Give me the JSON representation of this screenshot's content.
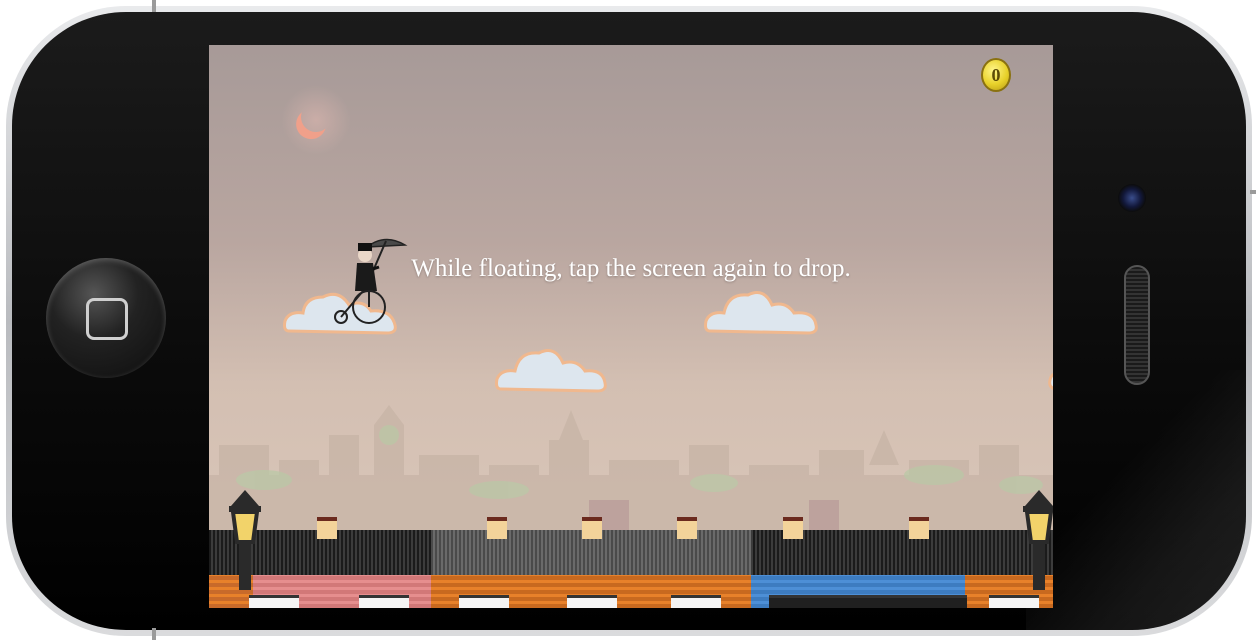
{
  "game": {
    "instruction": "While floating, tap the screen again to drop.",
    "coin_count": "0"
  },
  "colors": {
    "sky_top": "#a79a98",
    "sky_bottom": "#dcc9bb",
    "cloud_fill": "#dde6ee",
    "cloud_outline": "#f0b88e",
    "moon": "#f0a08a",
    "coin": "#e8d12a",
    "bricks_pink": "#e68e8e",
    "bricks_orange": "#e8812a",
    "bricks_blue": "#4d8fd6"
  },
  "icons": [
    "moon-icon",
    "coin-icon",
    "street-lamp-icon",
    "umbrella-icon",
    "penny-farthing-icon"
  ]
}
